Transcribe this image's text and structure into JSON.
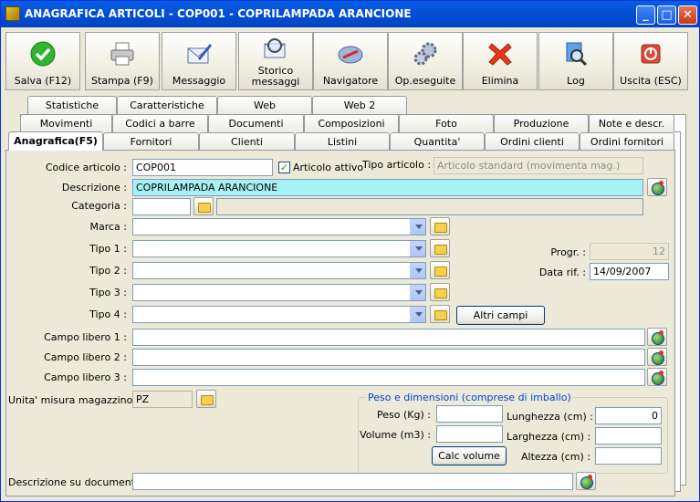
{
  "window": {
    "title": "ANAGRAFICA ARTICOLI - COP001 - COPRILAMPADA ARANCIONE",
    "minimize": "_",
    "maximize": "□",
    "close": "✕"
  },
  "toolbar": [
    {
      "label": "Salva (F12)",
      "icon": "save-check-icon"
    },
    {
      "label": "Stampa (F9)",
      "icon": "printer-icon"
    },
    {
      "label": "Messaggio",
      "icon": "envelope-pen-icon"
    },
    {
      "label": "Storico messaggi",
      "line1": "Storico",
      "line2": "messaggi",
      "icon": "envelope-search-icon"
    },
    {
      "label": "Navigatore",
      "icon": "compass-icon"
    },
    {
      "label": "Op.eseguite",
      "icon": "gears-icon"
    },
    {
      "label": "Elimina",
      "icon": "red-x-icon"
    },
    {
      "label": "Log",
      "icon": "log-magnifier-icon"
    },
    {
      "label": "Uscita (ESC)",
      "icon": "exit-icon"
    }
  ],
  "tabs": {
    "row1": [
      "Statistiche",
      "Caratteristiche",
      "Web",
      "Web 2"
    ],
    "row2": [
      "Movimenti",
      "Codici a barre",
      "Documenti",
      "Composizioni",
      "Foto",
      "Produzione",
      "Note e descr."
    ],
    "row3": [
      "Anagrafica(F5)",
      "Fornitori",
      "Clienti",
      "Listini",
      "Quantita'",
      "Ordini clienti",
      "Ordini fornitori"
    ]
  },
  "form": {
    "codice_label": "Codice articolo :",
    "codice_value": "COP001",
    "attivo_label": "Articolo attivo",
    "attivo_checked": "✓",
    "tipo_articolo_label": "Tipo articolo :",
    "tipo_articolo_value": "Articolo standard (movimenta mag.)",
    "descrizione_label": "Descrizione :",
    "descrizione_value": "COPRILAMPADA ARANCIONE",
    "categoria_label": "Categoria :",
    "categoria_value": "",
    "marca_label": "Marca :",
    "tipo1_label": "Tipo 1 :",
    "tipo2_label": "Tipo 2 :",
    "tipo3_label": "Tipo 3 :",
    "tipo4_label": "Tipo 4 :",
    "altri_campi": "Altri campi",
    "progr_label": "Progr. :",
    "progr_value": "12",
    "data_rif_label": "Data rif. :",
    "data_rif_value": "14/09/2007",
    "campo1_label": "Campo libero 1 :",
    "campo2_label": "Campo libero 2 :",
    "campo3_label": "Campo libero 3 :",
    "um_label": "Unita' misura magazzino :",
    "um_value": "PZ",
    "peso_group": "Peso e dimensioni (comprese di imballo)",
    "peso_label": "Peso (Kg) :",
    "volume_label": "Volume (m3) :",
    "calc_volume": "Calc volume",
    "lunghezza_label": "Lunghezza (cm) :",
    "lunghezza_value": "0",
    "larghezza_label": "Larghezza (cm) :",
    "altezza_label": "Altezza (cm) :",
    "descr_doc_label": "Descrizione su documenti:"
  }
}
